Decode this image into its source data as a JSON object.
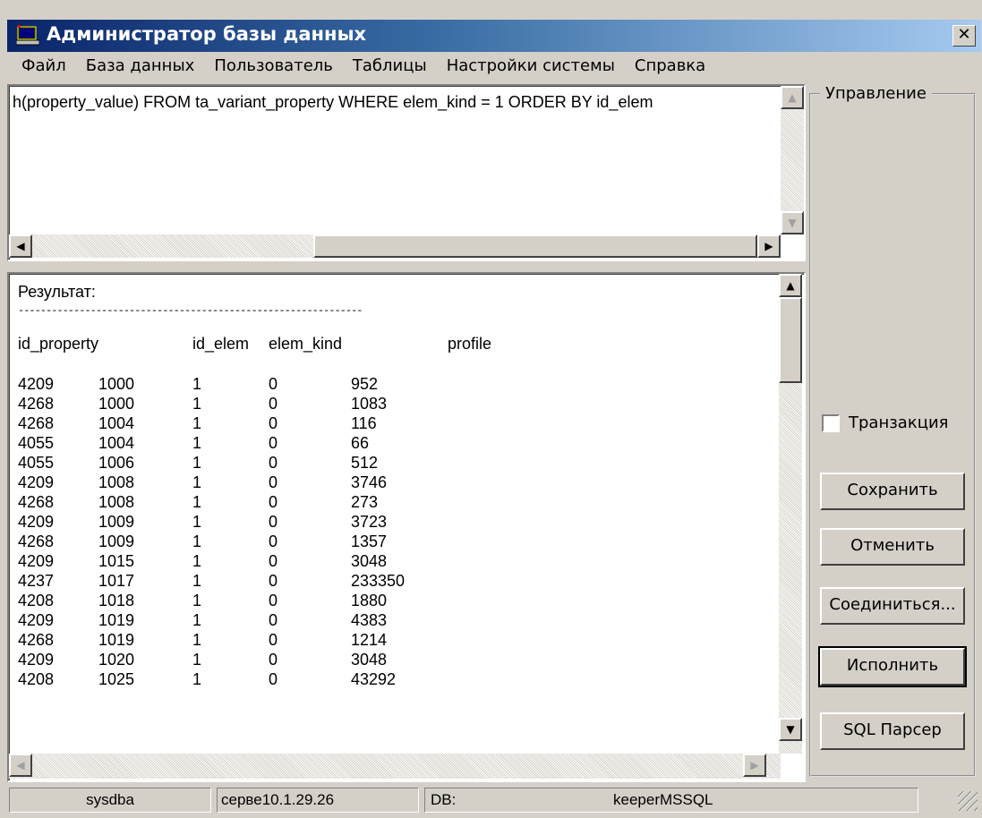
{
  "window": {
    "title": "Администратор базы данных",
    "close_glyph": "✕"
  },
  "menu": [
    "Файл",
    "База данных",
    "Пользователь",
    "Таблицы",
    "Настройки системы",
    "Справка"
  ],
  "query": {
    "text": "h(property_value) FROM ta_variant_property WHERE elem_kind = 1 ORDER BY id_elem"
  },
  "result": {
    "title": "Результат:",
    "separator": "--------------------------------------------------------------",
    "headers": [
      "id_property",
      "id_elem",
      "elem_kind",
      "profile"
    ],
    "rows": [
      [
        "4209",
        "1000",
        "1",
        "0",
        "952"
      ],
      [
        "4268",
        "1000",
        "1",
        "0",
        "1083"
      ],
      [
        "4268",
        "1004",
        "1",
        "0",
        "116"
      ],
      [
        "4055",
        "1004",
        "1",
        "0",
        "66"
      ],
      [
        "4055",
        "1006",
        "1",
        "0",
        "512"
      ],
      [
        "4209",
        "1008",
        "1",
        "0",
        "3746"
      ],
      [
        "4268",
        "1008",
        "1",
        "0",
        "273"
      ],
      [
        "4209",
        "1009",
        "1",
        "0",
        "3723"
      ],
      [
        "4268",
        "1009",
        "1",
        "0",
        "1357"
      ],
      [
        "4209",
        "1015",
        "1",
        "0",
        "3048"
      ],
      [
        "4237",
        "1017",
        "1",
        "0",
        "233350"
      ],
      [
        "4208",
        "1018",
        "1",
        "0",
        "1880"
      ],
      [
        "4209",
        "1019",
        "1",
        "0",
        "4383"
      ],
      [
        "4268",
        "1019",
        "1",
        "0",
        "1214"
      ],
      [
        "4209",
        "1020",
        "1",
        "0",
        "3048"
      ],
      [
        "4208",
        "1025",
        "1",
        "0",
        "43292"
      ]
    ]
  },
  "panel": {
    "group_label": "Управление",
    "transaction_label": "Транзакция",
    "transaction_checked": false,
    "save_label": "Сохранить",
    "cancel_label": "Отменить",
    "connect_label": "Соединиться...",
    "execute_label": "Исполнить",
    "sql_parser_label": "SQL Парсер"
  },
  "status": {
    "user": "sysdba",
    "server": "серве10.1.29.26",
    "db_label": "DB:",
    "db_name": "keeperMSSQL"
  },
  "icons": {
    "scroll_up": "▲",
    "scroll_down": "▼",
    "scroll_left": "◀",
    "scroll_right": "▶"
  },
  "colors": {
    "title_start": "#0a246a",
    "title_end": "#a6caf0",
    "face": "#d4d0c8"
  }
}
